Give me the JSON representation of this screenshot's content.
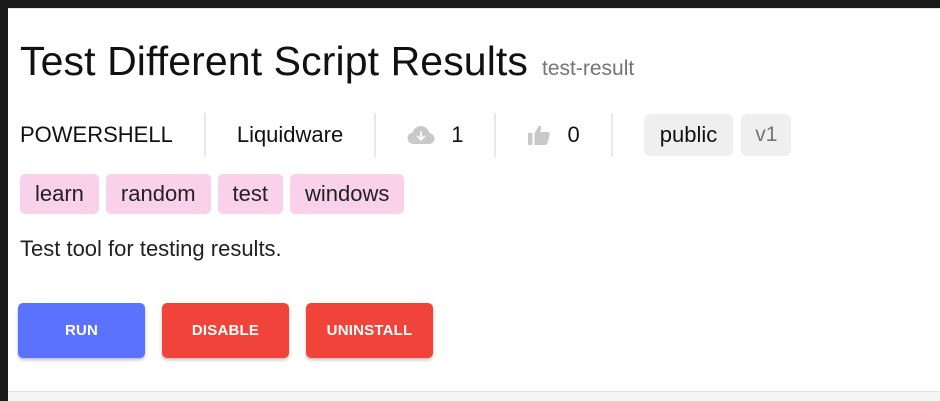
{
  "script": {
    "title": "Test Different Script Results",
    "slug": "test-result",
    "language": "POWERSHELL",
    "author": "Liquidware",
    "downloads": "1",
    "likes": "0",
    "visibility": "public",
    "version": "v1",
    "tags": [
      "learn",
      "random",
      "test",
      "windows"
    ],
    "description": "Test tool for testing results."
  },
  "icons": {
    "downloads": "cloud-download-icon",
    "likes": "thumbs-up-icon"
  },
  "actions": {
    "run_label": "RUN",
    "disable_label": "DISABLE",
    "uninstall_label": "UNINSTALL"
  },
  "colors": {
    "run": "#5b72ff",
    "danger": "#f0433a",
    "tag_background": "#fad1ea",
    "chip_background": "#efefef"
  }
}
